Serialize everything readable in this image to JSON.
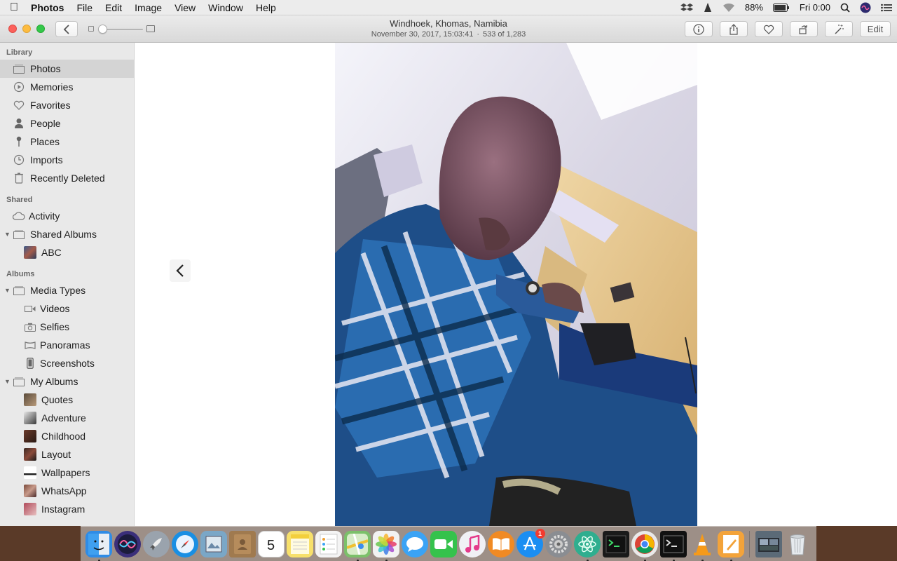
{
  "menubar": {
    "app_name": "Photos",
    "items": [
      "File",
      "Edit",
      "Image",
      "View",
      "Window",
      "Help"
    ],
    "battery": "88%",
    "clock": "Fri 0:00"
  },
  "window": {
    "title_location": "Windhoek, Khomas, Namibia",
    "title_datetime": "November 30, 2017, 15:03:41",
    "title_separator": "·",
    "title_position": "533 of 1,283",
    "toolbar": {
      "edit_label": "Edit"
    }
  },
  "sidebar": {
    "library_header": "Library",
    "library_items": [
      {
        "label": "Photos",
        "icon": "photos-icon"
      },
      {
        "label": "Memories",
        "icon": "memories-icon"
      },
      {
        "label": "Favorites",
        "icon": "heart-icon"
      },
      {
        "label": "People",
        "icon": "person-icon"
      },
      {
        "label": "Places",
        "icon": "pin-icon"
      },
      {
        "label": "Imports",
        "icon": "clock-icon"
      },
      {
        "label": "Recently Deleted",
        "icon": "trash-icon"
      }
    ],
    "shared_header": "Shared",
    "shared_items": [
      {
        "label": "Activity",
        "icon": "cloud-icon"
      },
      {
        "label": "Shared Albums",
        "icon": "album-icon"
      },
      {
        "label": "ABC",
        "icon": "album-thumbnail"
      }
    ],
    "albums_header": "Albums",
    "albums_items": [
      {
        "label": "Media Types",
        "icon": "album-icon"
      },
      {
        "label": "Videos",
        "icon": "video-icon"
      },
      {
        "label": "Selfies",
        "icon": "camera-icon"
      },
      {
        "label": "Panoramas",
        "icon": "panorama-icon"
      },
      {
        "label": "Screenshots",
        "icon": "phone-icon"
      },
      {
        "label": "My Albums",
        "icon": "album-icon"
      },
      {
        "label": "Quotes",
        "icon": "album-thumbnail"
      },
      {
        "label": "Adventure",
        "icon": "album-thumbnail"
      },
      {
        "label": "Childhood",
        "icon": "album-thumbnail"
      },
      {
        "label": "Layout",
        "icon": "album-thumbnail"
      },
      {
        "label": "Wallpapers",
        "icon": "album-thumbnail"
      },
      {
        "label": "WhatsApp",
        "icon": "album-thumbnail"
      },
      {
        "label": "Instagram",
        "icon": "album-thumbnail"
      }
    ]
  },
  "dock": {
    "apps": [
      {
        "name": "Finder",
        "color": "#2f8ce6"
      },
      {
        "name": "Siri",
        "color": "#3b2f7a"
      },
      {
        "name": "Launchpad",
        "color": "#9aa3ad"
      },
      {
        "name": "Safari",
        "color": "#1a8fe3"
      },
      {
        "name": "Preview",
        "color": "#7aa7c7"
      },
      {
        "name": "Contacts",
        "color": "#a07a4f"
      },
      {
        "name": "Calendar",
        "color": "#ffffff",
        "label": "5"
      },
      {
        "name": "Notes",
        "color": "#f7e06b"
      },
      {
        "name": "Reminders",
        "color": "#f4f4f4"
      },
      {
        "name": "Maps",
        "color": "#7cc06a"
      },
      {
        "name": "Photos",
        "color": "#f2f2f2"
      },
      {
        "name": "Messages",
        "color": "#3ba3f5"
      },
      {
        "name": "FaceTime",
        "color": "#35c24c"
      },
      {
        "name": "iTunes",
        "color": "#f0f0f5"
      },
      {
        "name": "iBooks",
        "color": "#f08a24"
      },
      {
        "name": "App Store",
        "color": "#1b8ef2",
        "badge": "1"
      },
      {
        "name": "System Preferences",
        "color": "#8a8d92"
      },
      {
        "name": "Atom",
        "color": "#2fae8f"
      },
      {
        "name": "Terminal Green",
        "color": "#1a1a1a"
      },
      {
        "name": "Chrome",
        "color": "#e9e9e9"
      },
      {
        "name": "Terminal",
        "color": "#111111"
      },
      {
        "name": "VLC",
        "color": "#f59a1a"
      },
      {
        "name": "Pages",
        "color": "#f3a33a"
      },
      {
        "name": "Screenshots Folder",
        "color": "#5b6a77"
      },
      {
        "name": "Trash",
        "color": "#d9dde0"
      }
    ]
  }
}
